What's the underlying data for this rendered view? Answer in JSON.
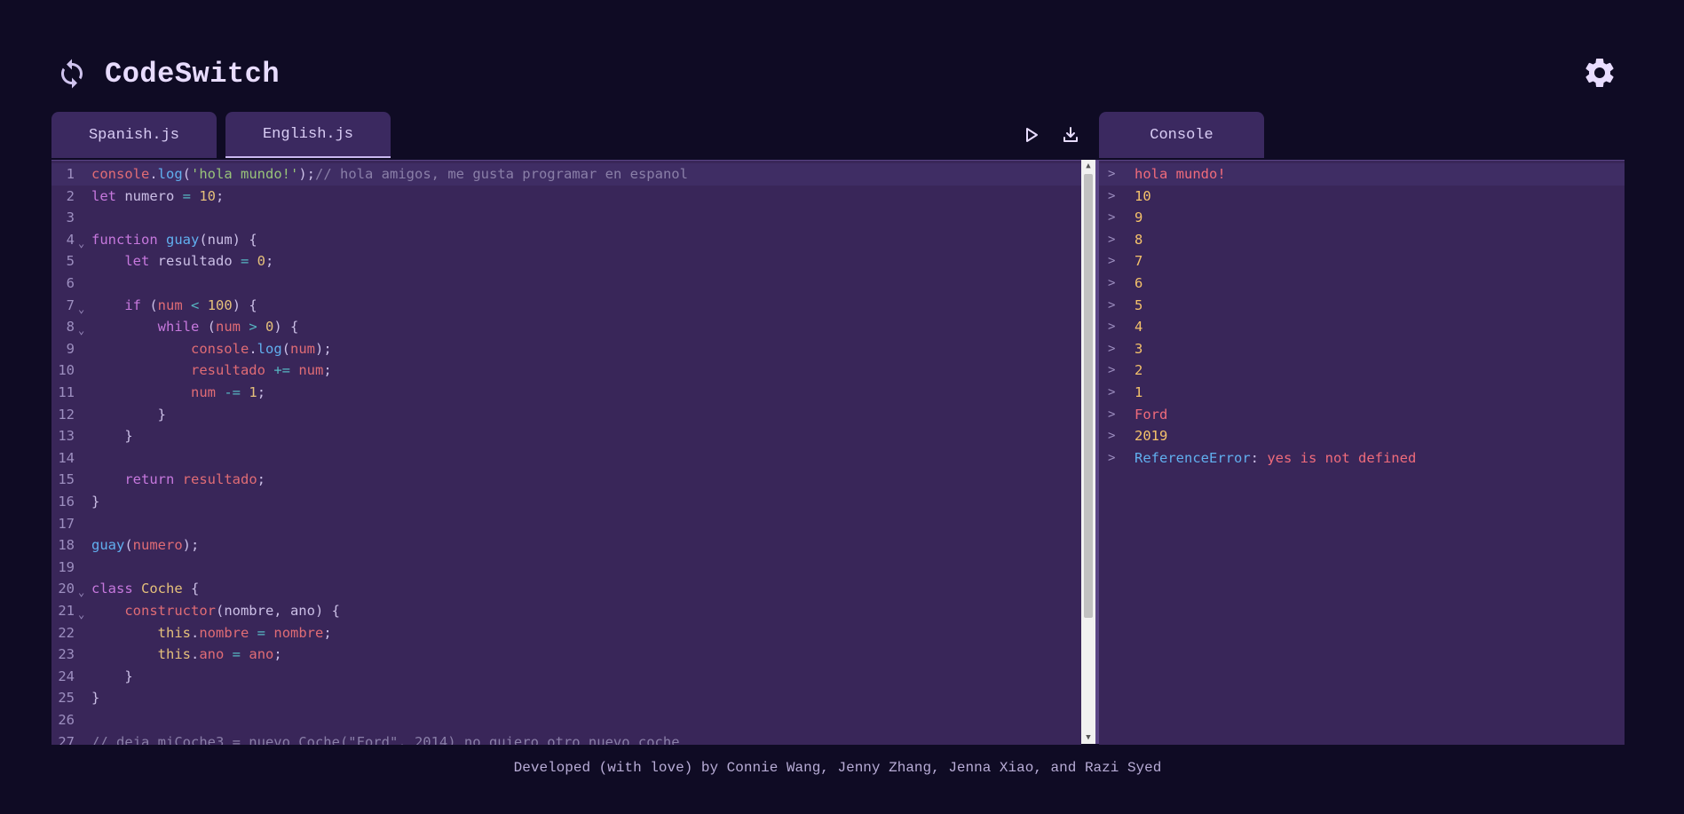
{
  "app": {
    "title": "CodeSwitch"
  },
  "tabs": [
    {
      "label": "Spanish.js",
      "active": false
    },
    {
      "label": "English.js",
      "active": true
    }
  ],
  "console_tab": {
    "label": "Console"
  },
  "toolbar": {
    "run_icon": "play-icon",
    "download_icon": "download-icon"
  },
  "editor": {
    "lines": [
      {
        "n": "1",
        "fold": false,
        "html": "<span class=\"var\">console</span>.<span class=\"fn\">log</span>(<span class=\"str\">'hola mundo!'</span>);<span class=\"cmt\">// hola amigos, me gusta programar en espanol</span>"
      },
      {
        "n": "2",
        "fold": false,
        "html": "<span class=\"kw\">let</span> numero <span class=\"op\">=</span> <span class=\"num\">10</span>;"
      },
      {
        "n": "3",
        "fold": false,
        "html": ""
      },
      {
        "n": "4",
        "fold": true,
        "html": "<span class=\"kw\">function</span> <span class=\"fn\">guay</span>(num) {"
      },
      {
        "n": "5",
        "fold": false,
        "html": "    <span class=\"kw\">let</span> resultado <span class=\"op\">=</span> <span class=\"num\">0</span>;"
      },
      {
        "n": "6",
        "fold": false,
        "html": ""
      },
      {
        "n": "7",
        "fold": true,
        "html": "    <span class=\"kw\">if</span> (<span class=\"var\">num</span> <span class=\"op\">&lt;</span> <span class=\"num\">100</span>) {"
      },
      {
        "n": "8",
        "fold": true,
        "html": "        <span class=\"kw\">while</span> (<span class=\"var\">num</span> <span class=\"op\">&gt;</span> <span class=\"num\">0</span>) {"
      },
      {
        "n": "9",
        "fold": false,
        "html": "            <span class=\"var\">console</span>.<span class=\"fn\">log</span>(<span class=\"var\">num</span>);"
      },
      {
        "n": "10",
        "fold": false,
        "html": "            <span class=\"var\">resultado</span> <span class=\"op\">+=</span> <span class=\"var\">num</span>;"
      },
      {
        "n": "11",
        "fold": false,
        "html": "            <span class=\"var\">num</span> <span class=\"op\">-=</span> <span class=\"num\">1</span>;"
      },
      {
        "n": "12",
        "fold": false,
        "html": "        }"
      },
      {
        "n": "13",
        "fold": false,
        "html": "    }"
      },
      {
        "n": "14",
        "fold": false,
        "html": ""
      },
      {
        "n": "15",
        "fold": false,
        "html": "    <span class=\"kw\">return</span> <span class=\"var\">resultado</span>;"
      },
      {
        "n": "16",
        "fold": false,
        "html": "}"
      },
      {
        "n": "17",
        "fold": false,
        "html": ""
      },
      {
        "n": "18",
        "fold": false,
        "html": "<span class=\"fn\">guay</span>(<span class=\"var\">numero</span>);"
      },
      {
        "n": "19",
        "fold": false,
        "html": ""
      },
      {
        "n": "20",
        "fold": true,
        "html": "<span class=\"kw\">class</span> <span class=\"cls\">Coche</span> {"
      },
      {
        "n": "21",
        "fold": true,
        "html": "    <span class=\"var\">constructor</span>(nombre, ano) {"
      },
      {
        "n": "22",
        "fold": false,
        "html": "        <span class=\"thisk\">this</span>.<span class=\"var\">nombre</span> <span class=\"op\">=</span> <span class=\"var\">nombre</span>;"
      },
      {
        "n": "23",
        "fold": false,
        "html": "        <span class=\"thisk\">this</span>.<span class=\"var\">ano</span> <span class=\"op\">=</span> <span class=\"var\">ano</span>;"
      },
      {
        "n": "24",
        "fold": false,
        "html": "    }"
      },
      {
        "n": "25",
        "fold": false,
        "html": "}"
      },
      {
        "n": "26",
        "fold": false,
        "html": ""
      },
      {
        "n": "27",
        "fold": false,
        "html": "<span class=\"cmt\">// deja miCoche3 = nuevo Coche(\"Ford\", 2014) no quiero otro nuevo coche</span>"
      }
    ]
  },
  "console": {
    "lines": [
      {
        "text": "hola mundo!",
        "kind": "c-red"
      },
      {
        "text": "10",
        "kind": "c-num"
      },
      {
        "text": "9",
        "kind": "c-num"
      },
      {
        "text": "8",
        "kind": "c-num"
      },
      {
        "text": "7",
        "kind": "c-num"
      },
      {
        "text": "6",
        "kind": "c-num"
      },
      {
        "text": "5",
        "kind": "c-num"
      },
      {
        "text": "4",
        "kind": "c-num"
      },
      {
        "text": "3",
        "kind": "c-num"
      },
      {
        "text": "2",
        "kind": "c-num"
      },
      {
        "text": "1",
        "kind": "c-num"
      },
      {
        "text": "Ford",
        "kind": "c-red"
      },
      {
        "text": "2019",
        "kind": "c-num"
      },
      {
        "text": "",
        "kind": "error",
        "err_name": "ReferenceError",
        "err_sep": ":",
        "err_msg": " yes is not defined"
      }
    ]
  },
  "footer": {
    "text": "Developed (with love) by Connie Wang, Jenny Zhang, Jenna Xiao, and Razi Syed"
  },
  "colors": {
    "background": "#0f0b24",
    "panel": "#392659",
    "tab": "#3b2960"
  }
}
